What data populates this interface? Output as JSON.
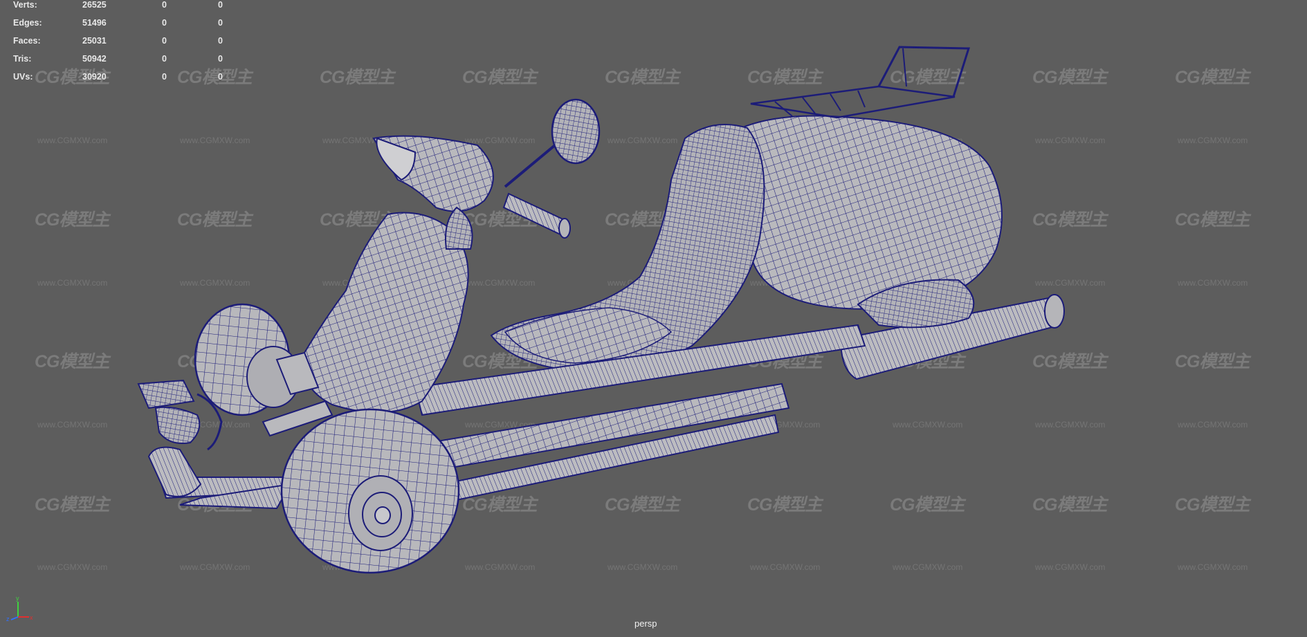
{
  "hud": {
    "rows": [
      {
        "label": "Verts:",
        "total": "26525",
        "selected": "0",
        "components": "0"
      },
      {
        "label": "Edges:",
        "total": "51496",
        "selected": "0",
        "components": "0"
      },
      {
        "label": "Faces:",
        "total": "25031",
        "selected": "0",
        "components": "0"
      },
      {
        "label": "Tris:",
        "total": "50942",
        "selected": "0",
        "components": "0"
      },
      {
        "label": "UVs:",
        "total": "30920",
        "selected": "0",
        "components": "0"
      }
    ]
  },
  "viewport": {
    "camera_label": "persp",
    "background_color": "#5d5d5d",
    "wireframe_color": "#1c1c78",
    "surface_color": "#b9b9bd"
  },
  "axis_gizmo": {
    "x_label": "x",
    "y_label": "y",
    "z_label": "z",
    "x_color": "#e03030",
    "y_color": "#40d040",
    "z_color": "#3070ff"
  },
  "watermark": {
    "logo_text": "CG模型主",
    "url_text": "www.CGMXW.com"
  }
}
